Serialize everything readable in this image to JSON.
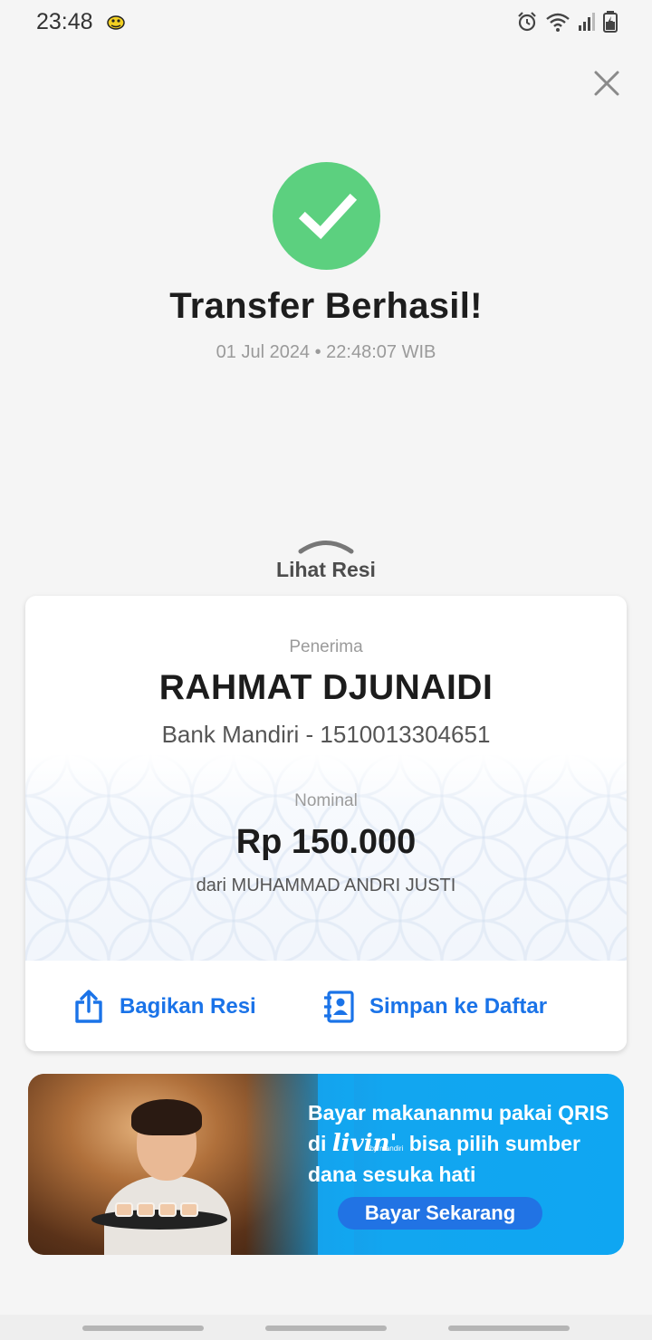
{
  "status_bar": {
    "time": "23:48",
    "icons": [
      "app-notification-icon",
      "alarm-icon",
      "wifi-icon",
      "signal-icon",
      "battery-icon"
    ]
  },
  "close_icon": "close-icon",
  "success": {
    "icon": "check-icon",
    "color": "#5cd07f",
    "title": "Transfer Berhasil!",
    "datetime": "01 Jul 2024 • 22:48:07 WIB"
  },
  "receipt_toggle": {
    "icon": "chevron-up-icon",
    "label": "Lihat Resi"
  },
  "receipt": {
    "recipient_label": "Penerima",
    "recipient_name": "RAHMAT DJUNAIDI",
    "recipient_bank": "Bank Mandiri - 1510013304651",
    "amount_label": "Nominal",
    "amount": "Rp 150.000",
    "from": "dari MUHAMMAD ANDRI JUSTI"
  },
  "actions": {
    "share": {
      "icon": "share-icon",
      "label": "Bagikan Resi"
    },
    "save": {
      "icon": "contact-add-icon",
      "label": "Simpan ke Daftar"
    },
    "accent": "#1a73e8"
  },
  "banner": {
    "line1": "Bayar makananmu pakai QRIS",
    "line2_prefix": "di",
    "brand": "livin'",
    "brand_sub": "by mandiri",
    "line2_suffix": "bisa pilih sumber",
    "line3": "dana sesuka hati",
    "cta": "Bayar Sekarang",
    "bg_color": "#12a6f0",
    "cta_color": "#2173e4"
  }
}
